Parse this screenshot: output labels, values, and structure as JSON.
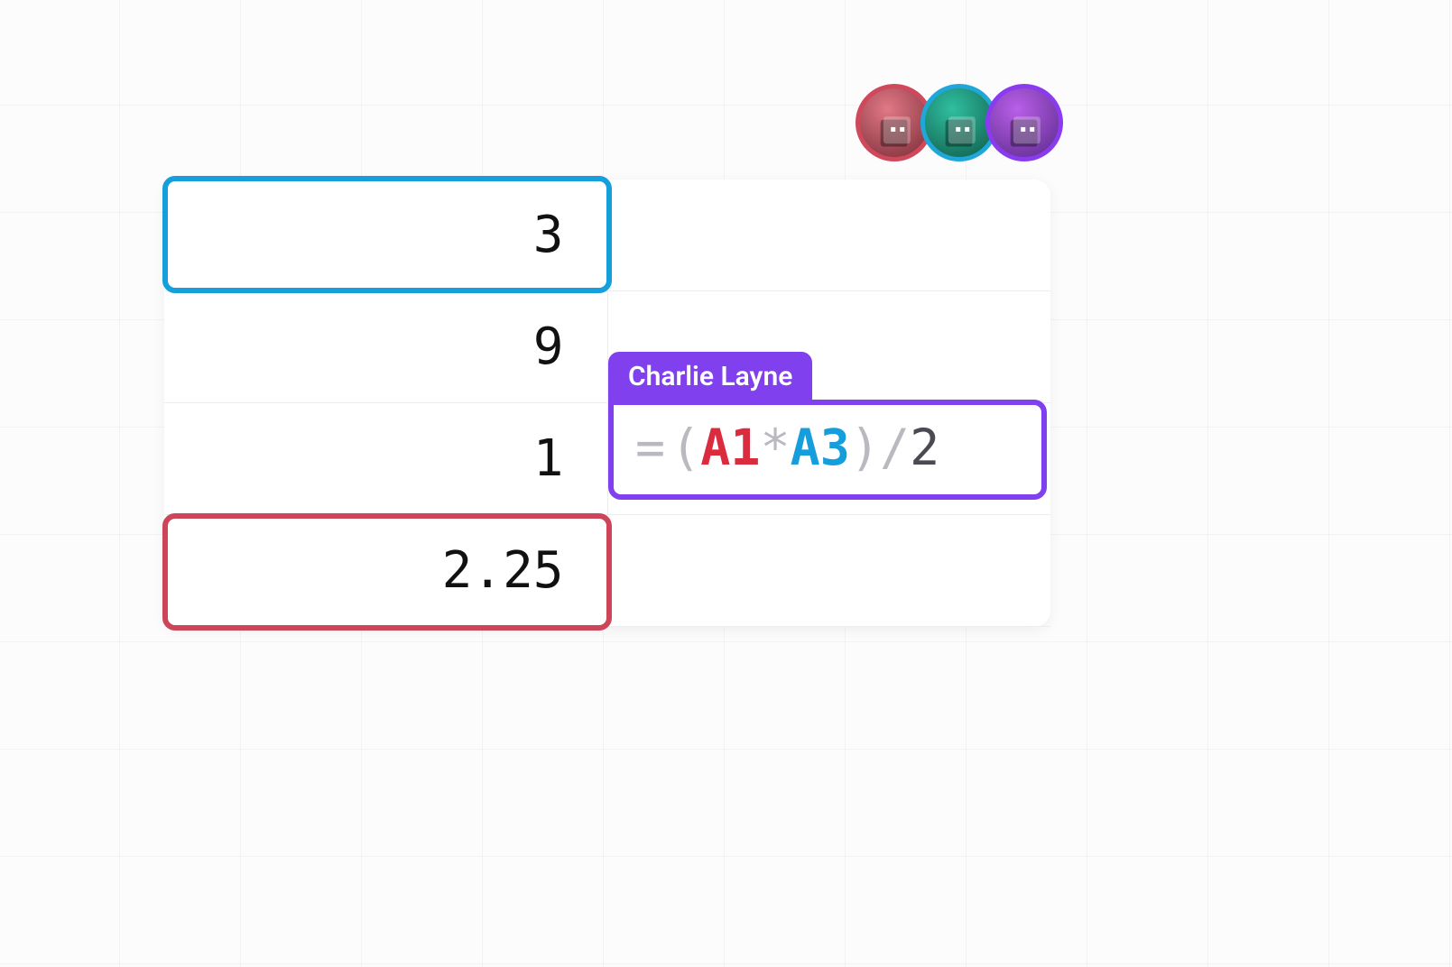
{
  "colors": {
    "blue": "#159fdb",
    "red": "#cd4558",
    "purple": "#8040ee"
  },
  "avatars": [
    {
      "color": "red"
    },
    {
      "color": "teal"
    },
    {
      "color": "purple"
    }
  ],
  "sheet": {
    "rows": [
      {
        "A": "3",
        "B": ""
      },
      {
        "A": "9",
        "B": ""
      },
      {
        "A": "1",
        "B": ""
      },
      {
        "A": "2.25",
        "B": ""
      }
    ]
  },
  "selections": {
    "A1": {
      "color": "blue"
    },
    "A4": {
      "color": "red"
    }
  },
  "collaborator": {
    "name": "Charlie Layne",
    "formula": {
      "eq": "=",
      "lparen": "(",
      "ref1": "A1",
      "star": "*",
      "ref2": "A3",
      "rparen": ")",
      "slash": "/",
      "num": "2"
    }
  }
}
